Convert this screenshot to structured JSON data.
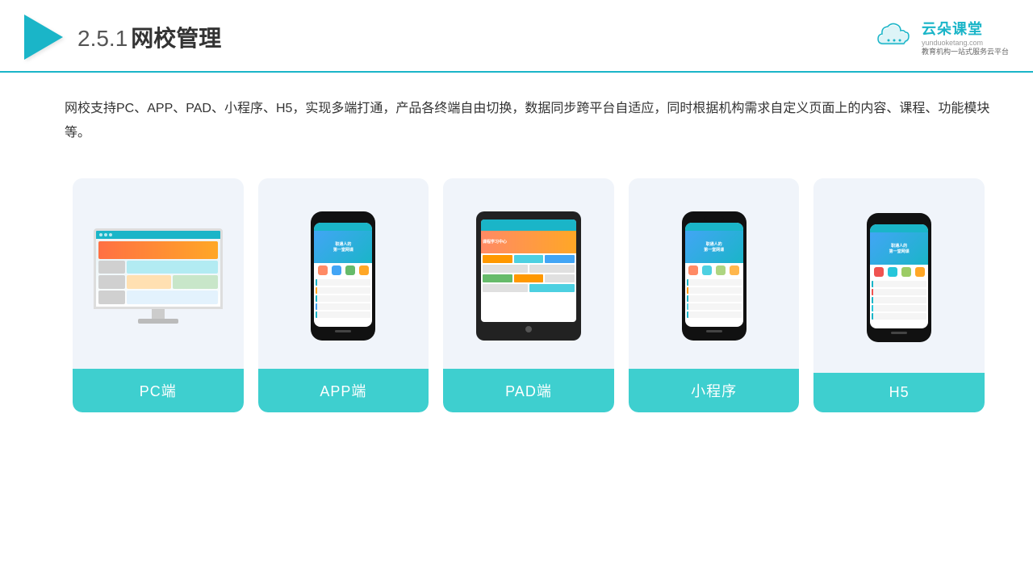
{
  "header": {
    "title": "网校管理",
    "title_num": "2.5.1",
    "brand_name": "云朵课堂",
    "brand_url": "yunduoketang.com",
    "brand_tagline": "教育机构一站\n式服务云平台"
  },
  "description": "网校支持PC、APP、PAD、小程序、H5，实现多端打通，产品各终端自由切换，数据同步跨平台自适应，同时根据机构需求自定义页面上的内容、课程、功能模块等。",
  "devices": [
    {
      "id": "pc",
      "label": "PC端",
      "type": "pc"
    },
    {
      "id": "app",
      "label": "APP端",
      "type": "phone"
    },
    {
      "id": "pad",
      "label": "PAD端",
      "type": "tablet"
    },
    {
      "id": "miniprogram",
      "label": "小程序",
      "type": "phone"
    },
    {
      "id": "h5",
      "label": "H5",
      "type": "phone"
    }
  ]
}
